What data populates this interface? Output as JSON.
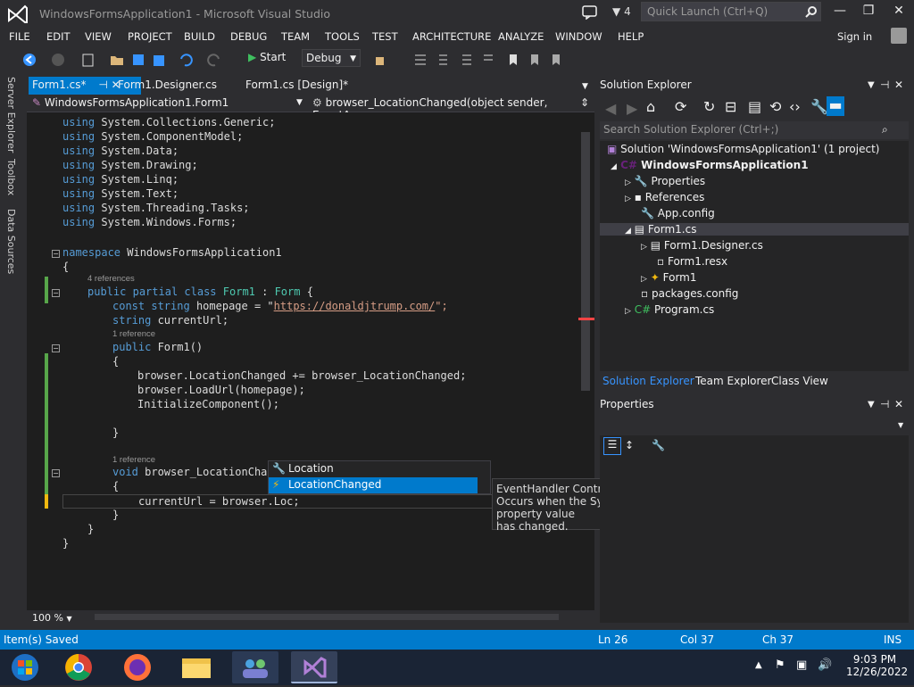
{
  "window": {
    "title": "WindowsFormsApplication1 - Microsoft Visual Studio",
    "notification_count": "4",
    "quick_launch_placeholder": "Quick Launch (Ctrl+Q)"
  },
  "menu": {
    "items": [
      "FILE",
      "EDIT",
      "VIEW",
      "PROJECT",
      "BUILD",
      "DEBUG",
      "TEAM",
      "TOOLS",
      "TEST",
      "ARCHITECTURE",
      "ANALYZE",
      "WINDOW",
      "HELP"
    ],
    "sign_in": "Sign in"
  },
  "toolbar": {
    "start_label": "Start",
    "configuration": "Debug"
  },
  "left_tabs": [
    "Server Explorer",
    "Toolbox",
    "Data Sources"
  ],
  "doc_tabs": [
    {
      "label": "Form1.cs*"
    },
    {
      "label": "Form1.Designer.cs"
    },
    {
      "label": "Form1.cs [Design]*"
    }
  ],
  "nav": {
    "class_dropdown": "WindowsFormsApplication1.Form1",
    "member_dropdown": "browser_LocationChanged(object sender, EventArgs"
  },
  "code": {
    "l1": "System.Collections.Generic;",
    "l2": "System.ComponentModel;",
    "l3": "System.Data;",
    "l4": "System.Drawing;",
    "l5": "System.Linq;",
    "l6": "System.Text;",
    "l7": "System.Threading.Tasks;",
    "l8": "System.Windows.Forms;",
    "using": "using",
    "namespace_kw": "namespace",
    "namespace_name": " WindowsFormsApplication1",
    "ref4": "4 references",
    "public": "public",
    "partial": "partial",
    "class": "class",
    "form1": "Form1",
    "colon": " : ",
    "form": "Form",
    "brace_open": " {",
    "const": "const",
    "string": "string",
    "homepage_decl": " homepage = \"",
    "url": "https://donaldjtrump.com/",
    "url_end": "\";",
    "currenturl_decl": " currentUrl;",
    "ref1": "1 reference",
    "ctor": " Form1()",
    "lbrace": "{",
    "rbrace": "}",
    "loc_changed_line": "browser.LocationChanged += browser_LocationChanged;",
    "loadurl_line": "browser.LoadUrl(homepage);",
    "init_line": "InitializeComponent();",
    "void": "void",
    "handler_partial": " browser_LocationChan",
    "current_line": "currentUrl = browser.Loc;"
  },
  "autocomplete": {
    "items": [
      {
        "label": "Location"
      },
      {
        "label": "LocationChanged"
      }
    ]
  },
  "tooltip": {
    "line1": "EventHandler Control.LocationChanged",
    "line2": "Occurs when the System.Windows.Forms.Control.Location property value",
    "line3": "has changed."
  },
  "editor": {
    "zoom": "100 %"
  },
  "solution_explorer": {
    "title": "Solution Explorer",
    "search_placeholder": "Search Solution Explorer (Ctrl+;)",
    "tree": [
      {
        "label": "Solution 'WindowsFormsApplication1' (1 project)"
      },
      {
        "label": "WindowsFormsApplication1"
      },
      {
        "label": "Properties"
      },
      {
        "label": "References"
      },
      {
        "label": "App.config"
      },
      {
        "label": "Form1.cs"
      },
      {
        "label": "Form1.Designer.cs"
      },
      {
        "label": "Form1.resx"
      },
      {
        "label": "Form1"
      },
      {
        "label": "packages.config"
      },
      {
        "label": "Program.cs"
      }
    ],
    "tabs": [
      "Solution Explorer",
      "Team Explorer",
      "Class View"
    ]
  },
  "properties": {
    "title": "Properties"
  },
  "status": {
    "message": "Item(s) Saved",
    "ln": "Ln 26",
    "col": "Col 37",
    "ch": "Ch 37",
    "mode": "INS"
  },
  "clock": {
    "time": "9:03 PM",
    "date": "12/26/2022"
  },
  "colors": {
    "accent": "#007acc",
    "editor_bg": "#1e1e1e",
    "chrome_bg": "#2d2d30",
    "keyword": "#569cd6",
    "type": "#4ec9b0",
    "string": "#d69d85"
  }
}
